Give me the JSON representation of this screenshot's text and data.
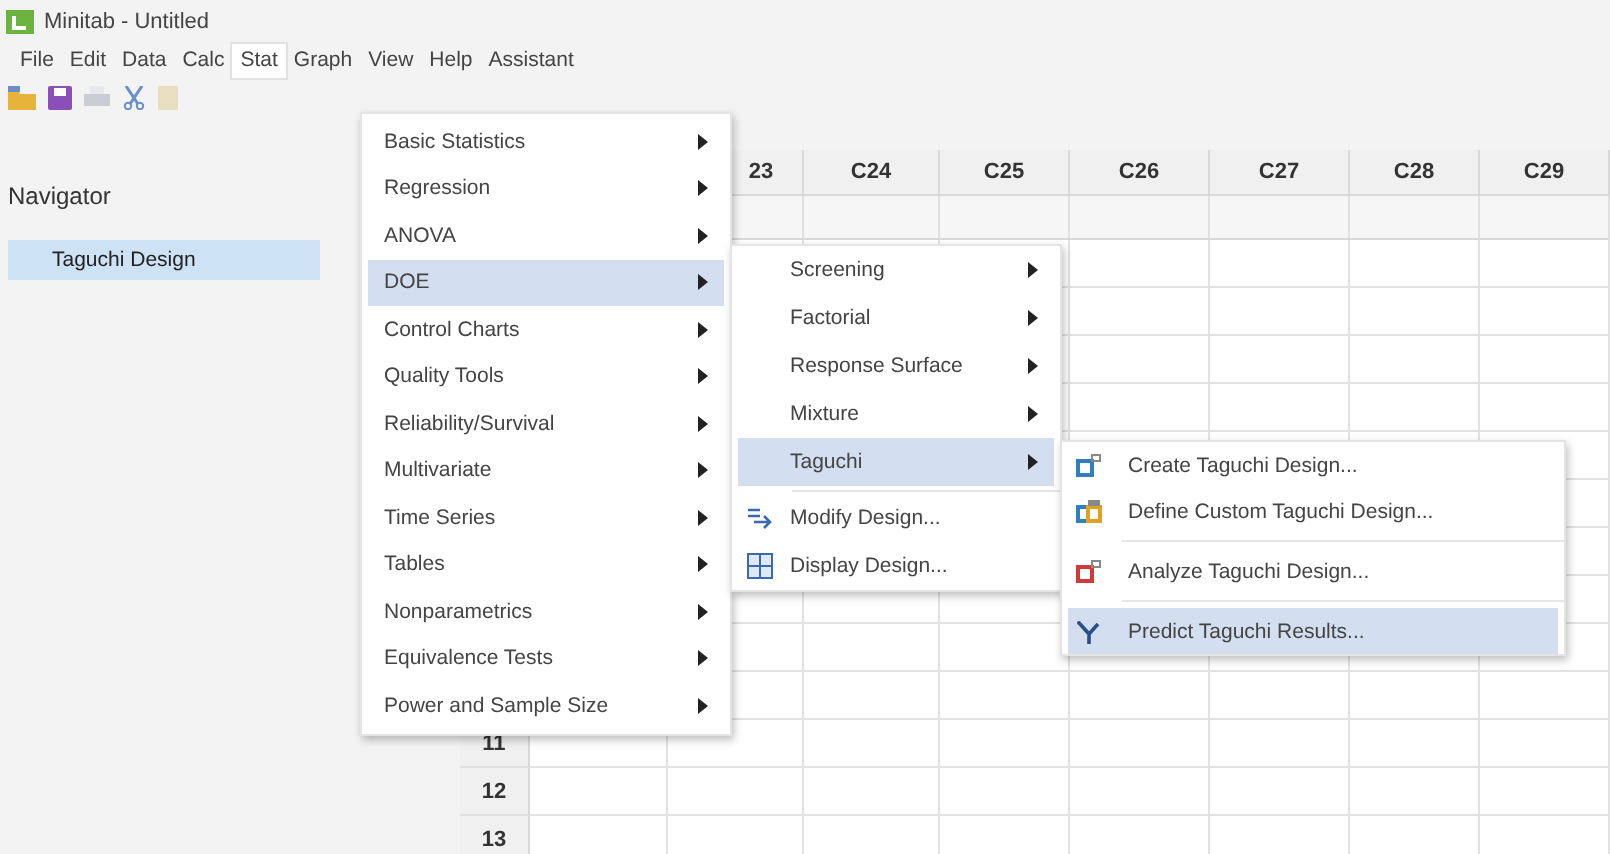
{
  "window": {
    "title": "Minitab - Untitled"
  },
  "menubar": [
    {
      "label": "File",
      "selected": false
    },
    {
      "label": "Edit",
      "selected": false
    },
    {
      "label": "Data",
      "selected": false
    },
    {
      "label": "Calc",
      "selected": false
    },
    {
      "label": "Stat",
      "selected": true
    },
    {
      "label": "Graph",
      "selected": false
    },
    {
      "label": "View",
      "selected": false
    },
    {
      "label": "Help",
      "selected": false
    },
    {
      "label": "Assistant",
      "selected": false
    }
  ],
  "navigator": {
    "title": "Navigator",
    "items": [
      {
        "label": "Taguchi Design",
        "selected": true
      }
    ]
  },
  "worksheet": {
    "columns": [
      "23",
      "C24",
      "C25",
      "C26",
      "C27",
      "C28",
      "C29"
    ],
    "row_numbers": [
      "11",
      "12",
      "13"
    ]
  },
  "stat_menu": [
    {
      "label": "Basic Statistics",
      "kind": "submenu",
      "selected": false
    },
    {
      "label": "Regression",
      "kind": "submenu",
      "selected": false
    },
    {
      "label": "ANOVA",
      "kind": "submenu",
      "selected": false
    },
    {
      "label": "DOE",
      "kind": "submenu",
      "selected": true
    },
    {
      "label": "Control Charts",
      "kind": "submenu",
      "selected": false
    },
    {
      "label": "Quality Tools",
      "kind": "submenu",
      "selected": false
    },
    {
      "label": "Reliability/Survival",
      "kind": "submenu",
      "selected": false
    },
    {
      "label": "Multivariate",
      "kind": "submenu",
      "selected": false
    },
    {
      "label": "Time Series",
      "kind": "submenu",
      "selected": false
    },
    {
      "label": "Tables",
      "kind": "submenu",
      "selected": false
    },
    {
      "label": "Nonparametrics",
      "kind": "submenu",
      "selected": false
    },
    {
      "label": "Equivalence Tests",
      "kind": "submenu",
      "selected": false
    },
    {
      "label": "Power and Sample Size",
      "kind": "submenu",
      "selected": false
    }
  ],
  "doe_menu": [
    {
      "label": "Screening",
      "kind": "submenu",
      "selected": false
    },
    {
      "label": "Factorial",
      "kind": "submenu",
      "selected": false
    },
    {
      "label": "Response Surface",
      "kind": "submenu",
      "selected": false
    },
    {
      "label": "Mixture",
      "kind": "submenu",
      "selected": false
    },
    {
      "label": "Taguchi",
      "kind": "submenu",
      "selected": true
    },
    {
      "kind": "separator"
    },
    {
      "label": "Modify Design...",
      "kind": "command",
      "selected": false
    },
    {
      "label": "Display Design...",
      "kind": "command",
      "selected": false
    }
  ],
  "taguchi_menu": [
    {
      "label": "Create Taguchi Design...",
      "kind": "command",
      "selected": false
    },
    {
      "label": "Define Custom Taguchi Design...",
      "kind": "command",
      "selected": false
    },
    {
      "kind": "separator"
    },
    {
      "label": "Analyze Taguchi Design...",
      "kind": "command",
      "selected": false
    },
    {
      "kind": "separator"
    },
    {
      "label": "Predict Taguchi Results...",
      "kind": "command",
      "selected": true
    }
  ]
}
